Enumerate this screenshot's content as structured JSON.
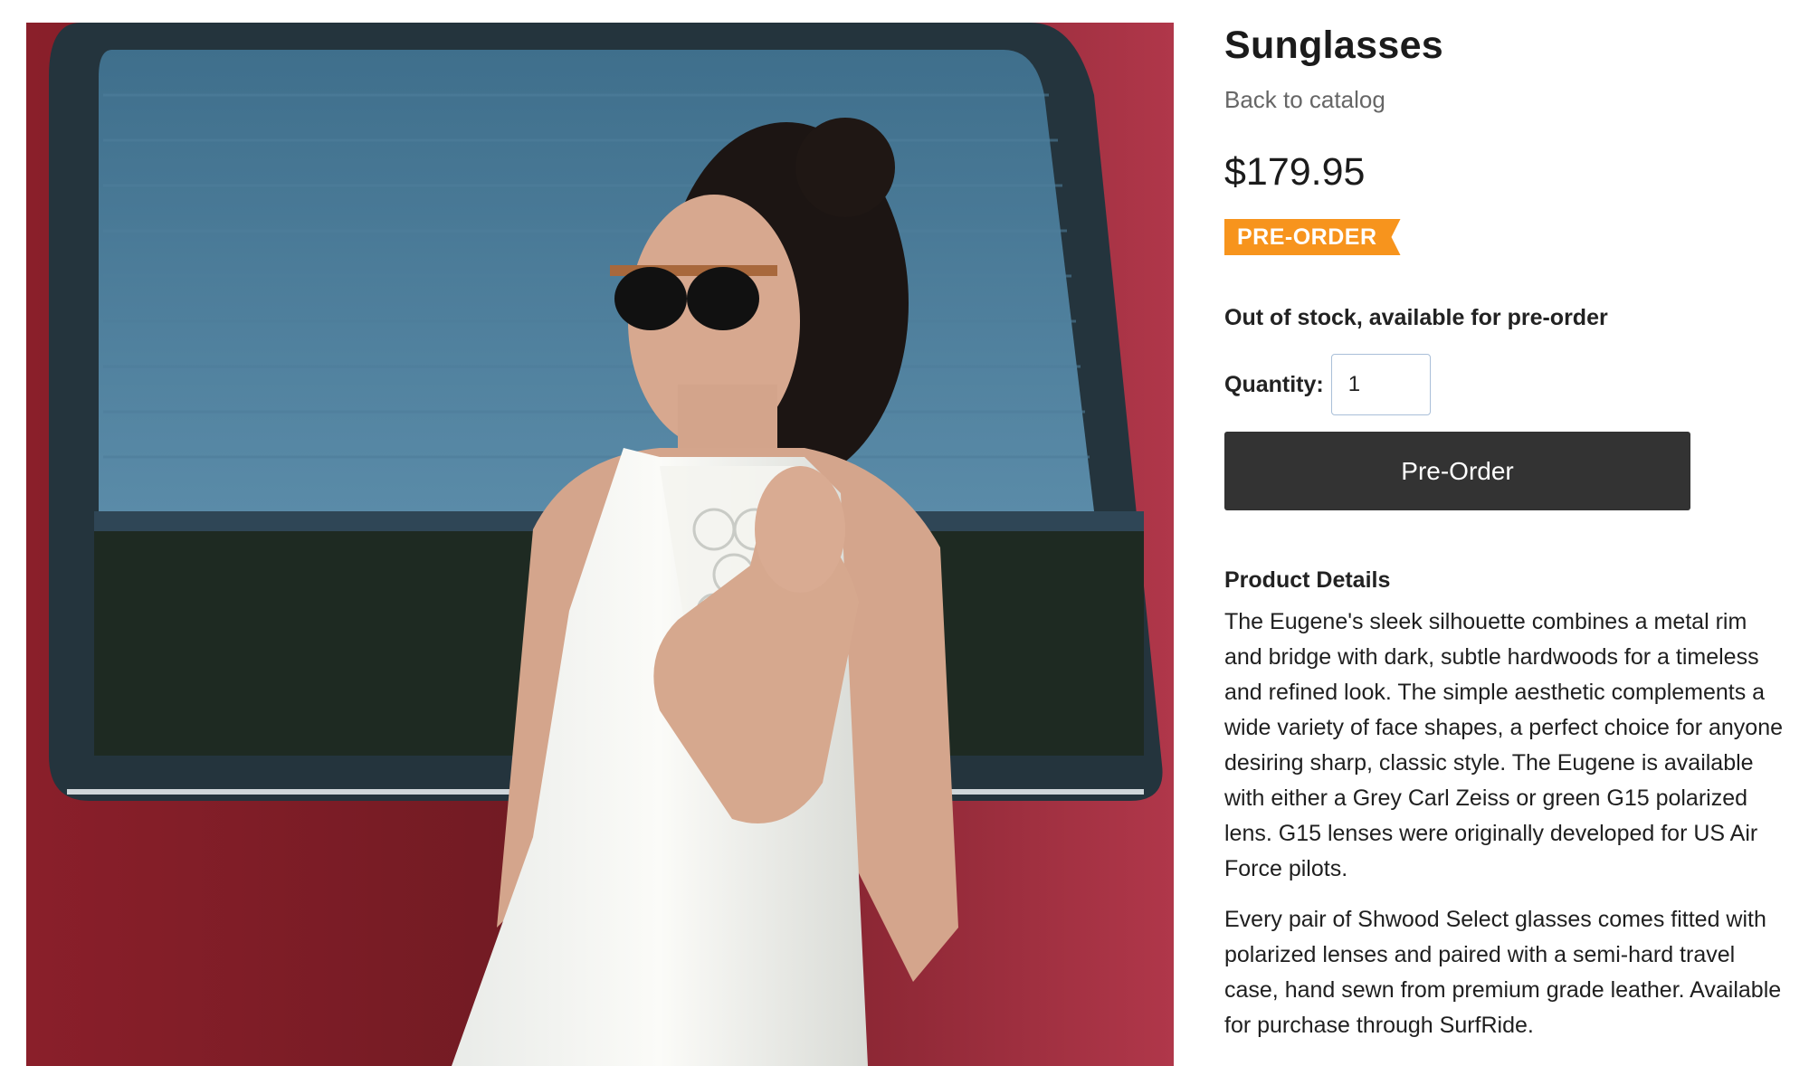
{
  "product": {
    "title": "Sunglasses",
    "back_link": "Back to catalog",
    "price": "$179.95",
    "badge": "PRE-ORDER",
    "stock_status": "Out of stock, available for pre-order",
    "quantity_label": "Quantity:",
    "quantity_value": "1",
    "preorder_button": "Pre-Order",
    "details_heading": "Product Details",
    "description": [
      "The Eugene's sleek silhouette combines a metal rim and bridge with dark, subtle hardwoods for a timeless and refined look. The simple aesthetic complements a wide variety of face shapes, a perfect choice for anyone desiring sharp, classic style. The Eugene is available with either a Grey Carl Zeiss or green G15 polarized lens. G15 lenses were originally developed for US Air Force pilots.",
      "Every pair of Shwood Select glasses comes fitted with polarized lenses and paired with a semi-hard travel case, hand sewn from premium grade leather. Available for purchase through SurfRide."
    ]
  },
  "colors": {
    "badge": "#f7941d",
    "button": "#333333",
    "link": "#666666"
  },
  "image": {
    "subject": "woman-wearing-sunglasses-photo"
  }
}
